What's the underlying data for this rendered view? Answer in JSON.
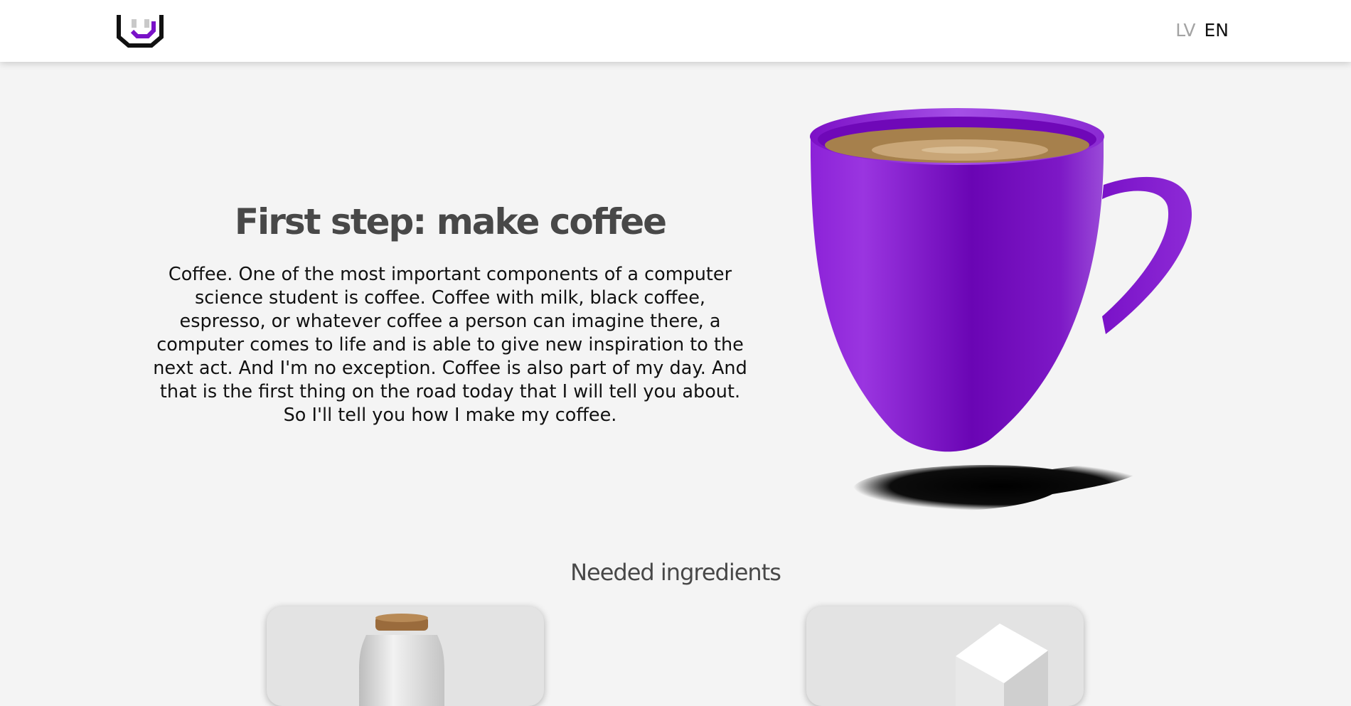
{
  "header": {
    "logo_icon": "u-bracket-logo-icon",
    "languages": [
      {
        "code": "LV",
        "active": false
      },
      {
        "code": "EN",
        "active": true
      }
    ]
  },
  "hero": {
    "title": "First step: make coffee",
    "text": "Coffee. One of the most important components of a computer science student is coffee. Coffee with milk, black coffee, espresso, or whatever coffee a person can imagine there, a computer comes to life and is able to give new inspiration to the next act. And I'm no exception. Coffee is also part of my day. And that is the first thing on the road today that I will tell you about. So I'll tell you how I make my coffee.",
    "image_icon": "purple-coffee-mug-icon"
  },
  "ingredients": {
    "title": "Needed ingredients",
    "items": [
      {
        "icon": "milk-bottle-icon"
      },
      {
        "icon": "sugar-cube-icon"
      }
    ]
  },
  "colors": {
    "accent": "#7a12c8",
    "background": "#f4f4f4",
    "heading": "#484848"
  }
}
